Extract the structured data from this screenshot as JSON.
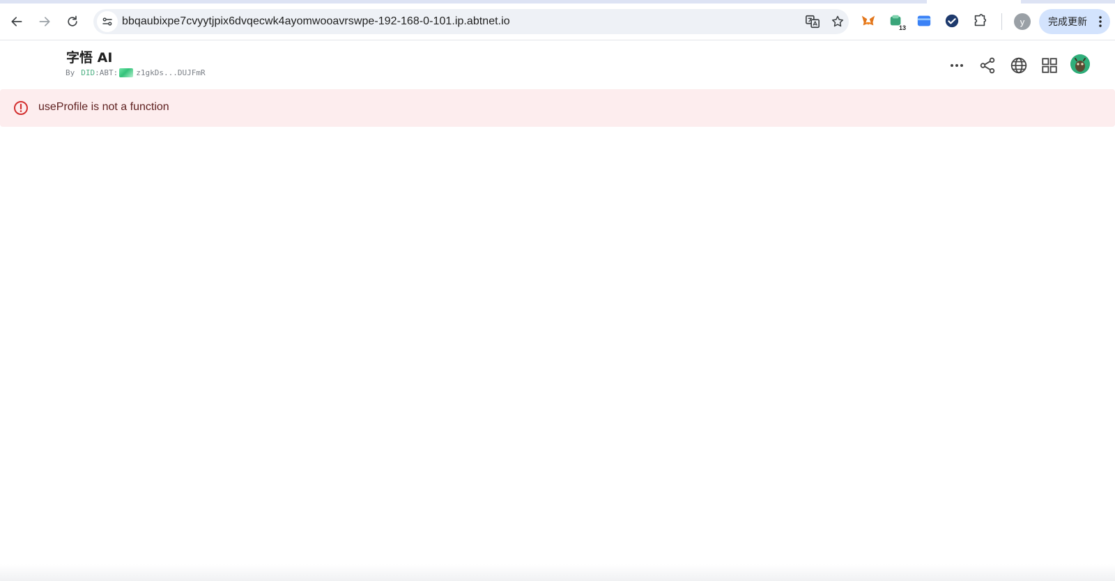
{
  "browser": {
    "url": "bbqaubixpe7cvyytjpix6dvqecwk4ayomwooavrswpe-192-168-0-101.ip.abtnet.io",
    "profile_initial": "y",
    "update_label": "完成更新",
    "extensions": [
      {
        "name": "metamask-extension-icon"
      },
      {
        "name": "wallet-extension-icon",
        "badge": "13"
      },
      {
        "name": "card-extension-icon"
      },
      {
        "name": "check-extension-icon"
      },
      {
        "name": "extensions-puzzle-icon"
      }
    ]
  },
  "app": {
    "title": "字悟 AI",
    "byline_prefix": "By",
    "did_label": "DID",
    "did_scheme": ":ABT:",
    "did_address": "z1gkDs...DUJFmR"
  },
  "error": {
    "message": "useProfile is not a function",
    "color": "#d32f2f"
  }
}
